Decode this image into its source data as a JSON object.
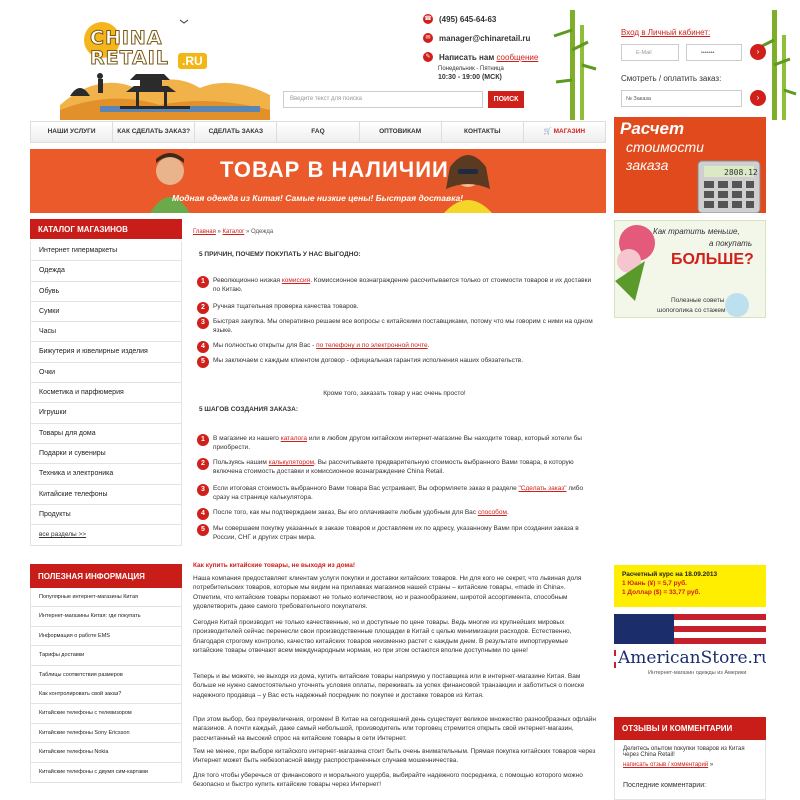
{
  "header": {
    "logo_word": "China Retail",
    "logo_line1": "CHINA",
    "logo_line2": "RETAIL",
    "logo_ru": ".RU",
    "phone": "(495) 645-64-63",
    "email": "manager@chinaretail.ru",
    "write_prefix": "Написать нам ",
    "write_link": "сообщение",
    "hours_days": "Понедельник - Пятница",
    "hours_time": "10:30 - 19:00 (МСК)",
    "search_placeholder": "Введите текст для поиска",
    "search_button": "ПОИСК",
    "login_title": "Вход в Личный кабинет:",
    "email_placeholder": "E-Mail",
    "password_value": "•••••••",
    "order_label": "Смотреть / оплатить заказ:",
    "order_placeholder": "№ Заказа"
  },
  "nav": [
    "НАШИ УСЛУГИ",
    "КАК СДЕЛАТЬ ЗАКАЗ?",
    "СДЕЛАТЬ ЗАКАЗ",
    "FAQ",
    "ОПТОВИКАМ",
    "КОНТАКТЫ",
    "МАГАЗИН"
  ],
  "banner": {
    "title": "ТОВАР В НАЛИЧИИ",
    "subtitle": "Модная одежда из Китая! Самые низкие цены! Быстрая доставка!"
  },
  "catalog": {
    "title": "КАТАЛОГ МАГАЗИНОВ",
    "items": [
      "Интернет гипермаркеты",
      "Одежда",
      "Обувь",
      "Сумки",
      "Часы",
      "Бижутерия и ювелирные изделия",
      "Очки",
      "Косметика и парфюмерия",
      "Игрушки",
      "Товары для дома",
      "Подарки и сувениры",
      "Техника и электроника",
      "Китайские телефоны",
      "Продукты"
    ],
    "all": "все разделы >>"
  },
  "info": {
    "title": "ПОЛЕЗНАЯ ИНФОРМАЦИЯ",
    "items": [
      "Популярные интернет-магазины Китая",
      "Интернет-магазины Китая: где покупать",
      "Информация о работе EMS",
      "Тарифы доставки",
      "Таблицы соответствия размеров",
      "Как контролировать свой заказ?",
      "Китайские телефоны с телевизором",
      "Китайские телефоны Sony Ericsson",
      "Китайские телефоны Nokia",
      "Китайские телефоны с двумя сим-картами"
    ]
  },
  "breadcrumb": {
    "home": "Главная",
    "catalog": "Каталог",
    "current": "Одежда"
  },
  "reasons": {
    "title": "5 ПРИЧИН, ПОЧЕМУ ПОКУПАТЬ У НАС ВЫГОДНО:",
    "items": [
      {
        "n": "1",
        "a": "Революционно низкая ",
        "link": "комиссия",
        "b": ". Комиссионное вознаграждение рассчитывается только от стоимости товаров и их доставки по Китаю."
      },
      {
        "n": "2",
        "a": "Ручная тщательная проверка качества товаров.",
        "link": "",
        "b": ""
      },
      {
        "n": "3",
        "a": "Быстрая закупка. Мы оперативно решаем все вопросы с китайскими поставщиками, потому что мы говорим с ними на одном языке.",
        "link": "",
        "b": ""
      },
      {
        "n": "4",
        "a": "Мы полностью открыты для Вас - ",
        "link": "по телефону и по электронной почте",
        "b": "."
      },
      {
        "n": "5",
        "a": "Мы заключаем с каждым клиентом договор - официальная гарантия исполнения наших обязательств.",
        "link": "",
        "b": ""
      }
    ],
    "after": "Кроме того, заказать товар у нас очень просто!"
  },
  "steps": {
    "title": "5 ШАГОВ СОЗДАНИЯ ЗАКАЗА:",
    "items": [
      {
        "n": "1",
        "a": "В магазине из нашего ",
        "link": "каталога",
        "b": " или в любом другом китайском интернет-магазине Вы находите товар, который хотели бы приобрести."
      },
      {
        "n": "2",
        "a": "Пользуясь нашим ",
        "link": "калькулятором",
        "b": ", Вы рассчитываете предварительную стоимость выбранного Вами товара, в которую включена стоимость доставки и комиссионное вознаграждение China Retail."
      },
      {
        "n": "3",
        "a": "Если итоговая стоимость выбранного Вами товара Вас устраивает, Вы оформляете заказ в разделе ",
        "link": "\"Сделать заказ\"",
        "b": " либо сразу на странице калькулятора."
      },
      {
        "n": "4",
        "a": "После того, как мы подтверждаем заказ, Вы его оплачиваете любым удобным для Вас ",
        "link": "способом",
        "b": "."
      },
      {
        "n": "5",
        "a": "Мы совершаем покупку указанных в заказе товаров и доставляем их по адресу, указанному Вами при создании заказа в России, СНГ и других стран мира.",
        "link": "",
        "b": ""
      }
    ]
  },
  "article": {
    "heading": "Как купить китайские товары, не выходя из дома!",
    "p1": "Наша компания предоставляет клиентам услуги покупки и доставки китайских товаров. Ни для кого не секрет, что львиная доля потребительских товаров, которые мы видим на прилавках магазинов нашей страны – китайские товары, «made in China». Отметим, что китайские товары поражают не только количеством, но и разнообразием, широтой ассортимента, способным удовлетворить даже самого требовательного покупателя.",
    "p2": "Сегодня Китай производит не только качественные, но и доступные по цене товары. Ведь многие из крупнейших мировых производителей сейчас перенесли свои производственные площадки в Китай с целью минимизации расходов. Естественно, благодаря строгому контролю, качество китайских товаров неизменно растет с каждым днем. В результате импортируемые китайские товары отвечают всем международным нормам, но при этом остаются вполне доступными по цене!",
    "p3": "Теперь и вы можете, не выходя из дома, купить китайские товары напрямую у поставщика или в интернет-магазине Китая. Вам больше не нужно самостоятельно уточнять условия оплаты, переживать за успех финансовой транзакции и заботиться о поиске надежного продавца – у Вас есть надежный посредник по покупке и доставке товаров из Китая.",
    "p4": "При этом выбор, без преувеличения, огромен! В Китае на сегодняшний день существует великое множество разнообразных офлайн магазинов. А почти каждый, даже самый небольшой, производитель или торговец стремится открыть свой интернет-магазин, рассчитанный на высокий спрос на китайские товары в сети Интернет.",
    "p5": "Тем не менее, при выборе китайского интернет-магазина стоит быть очень внимательным. Прямая покупка китайских товаров через Интернет может быть небезопасной ввиду распространенных случаев мошенничества.",
    "p6": "Для того чтобы уберечься от финансового и морального ущерба, выбирайте надежного посредника, с помощью которого можно безопасно и быстро купить китайские товары через Интернет!"
  },
  "right": {
    "calc_line1": "Расчет",
    "calc_line2": "стоимости",
    "calc_line3": "заказа",
    "calc_display": "2808.12",
    "spend_line1": "Как тратить меньше,",
    "spend_line2": "а покупать",
    "spend_line3": "БОЛЬШЕ?",
    "spend_foot1": "Полезные советы",
    "spend_foot2": "шопоголика со стажем",
    "rate_title": "Расчетный курс на 18.09.2013",
    "rate_yuan": "1 Юань (¥) = 5,7 руб.",
    "rate_usd": "1 Доллар ($) = 33,77 руб.",
    "american_brand": "AmericanStore.ru",
    "american_sub": "Интернет-магазин одежды из Америки",
    "reviews_title": "ОТЗЫВЫ И КОММЕНТАРИИ",
    "review_text": "Делитесь опытом покупки товаров из Китая через China Retail!",
    "review_link": "написать отзыв / комментарий",
    "review_arrow": "»",
    "recent": "Последние комментарии:"
  },
  "colors": {
    "accent": "#d0201b",
    "header_red": "#c81d19",
    "rate_bg": "#ffee00"
  }
}
